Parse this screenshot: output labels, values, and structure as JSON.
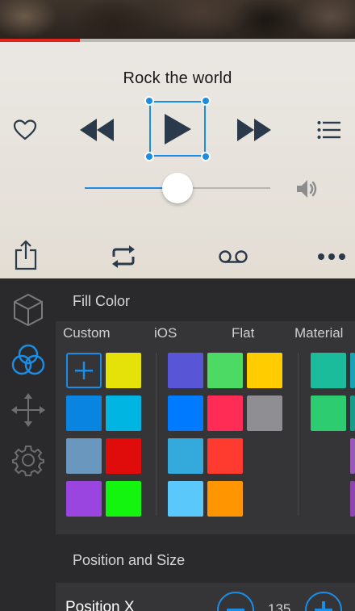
{
  "player": {
    "song_title": "Rock the world",
    "progress_percent": 22.5,
    "volume_percent": 50,
    "controls": {
      "heart_icon": "heart-icon",
      "rewind_icon": "rewind-icon",
      "play_icon": "play-icon",
      "forward_icon": "fast-forward-icon",
      "list_icon": "list-icon",
      "speaker_icon": "speaker-icon",
      "share_icon": "share-icon",
      "repeat_icon": "repeat-icon",
      "voicemail_icon": "voicemail-icon",
      "more_icon": "more-icon"
    },
    "accent_color": "#1a8de6",
    "progress_color": "#e0241b"
  },
  "inspector": {
    "rail_icons": [
      "cube-icon",
      "fill-circles-icon",
      "move-arrows-icon",
      "gear-icon"
    ],
    "fill_color": {
      "title": "Fill Color",
      "groups": [
        {
          "label": "Custom",
          "colors": [
            "add",
            "#e5e20a",
            "#0a84e1",
            "#00b5e1",
            "#6a97bd",
            "#e00b0b",
            "#9a45df",
            "#13f50f"
          ]
        },
        {
          "label": "iOS",
          "colors": [
            "#5856d6",
            "#4cd964",
            "#ffcc00",
            "#007aff",
            "#ff2d55",
            "#8e8e93",
            "#34aadc",
            "#ff3b30",
            "#5ac8fa",
            "#ff9500"
          ]
        },
        {
          "label": "Flat",
          "colors": []
        },
        {
          "label": "Material",
          "colors": [
            "#1abc9c",
            "#16a085",
            "#2ecc71",
            "#27ae60"
          ]
        }
      ]
    },
    "position_size": {
      "title": "Position and Size",
      "position_x_label": "Position X",
      "position_x_value": "135"
    }
  }
}
